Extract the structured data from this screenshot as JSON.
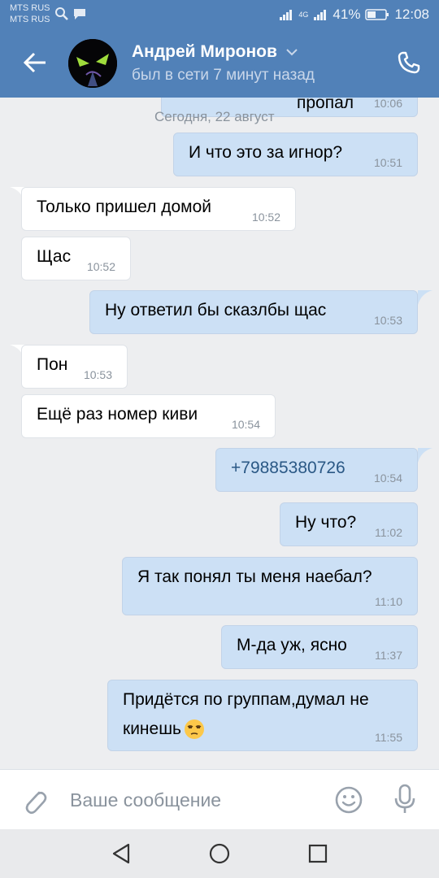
{
  "statusbar": {
    "carrier1": "MTS RUS",
    "carrier2": "MTS RUS",
    "network": "4G",
    "battery": "41%",
    "time": "12:08"
  },
  "header": {
    "name": "Андрей Миронов",
    "status": "был в сети 7 минут назад"
  },
  "chat": {
    "partial_prev_text": "пропал",
    "partial_prev_time": "10:06",
    "date_separator": "Сегодня, 22 август",
    "messages": [
      {
        "dir": "out",
        "text": "И что это за игнор?",
        "time": "10:51"
      },
      {
        "dir": "in",
        "text": "Только пришел домой",
        "time": "10:52"
      },
      {
        "dir": "in",
        "text": "Щас",
        "time": "10:52"
      },
      {
        "dir": "out",
        "text": "Ну ответил бы сказлбы щас",
        "time": "10:53"
      },
      {
        "dir": "in",
        "text": "Пон",
        "time": "10:53"
      },
      {
        "dir": "in",
        "text": "Ещё раз номер киви",
        "time": "10:54"
      },
      {
        "dir": "out",
        "text": "+79885380726",
        "time": "10:54"
      },
      {
        "dir": "out",
        "text": "Ну что?",
        "time": "11:02"
      },
      {
        "dir": "out",
        "text": "Я так понял ты меня наебал?",
        "time": "11:10"
      },
      {
        "dir": "out",
        "text": "М-да уж, ясно",
        "time": "11:37"
      },
      {
        "dir": "out",
        "text_line1": "Придётся по группам,думал не",
        "text_line2": "кинешь",
        "time": "11:55"
      }
    ]
  },
  "input": {
    "placeholder": "Ваше сообщение"
  },
  "colors": {
    "header": "#5181b8",
    "incoming": "#ffffff",
    "outgoing": "#cce0f5",
    "background": "#edeef0",
    "link": "#2a5885"
  },
  "icons": [
    "search-icon",
    "chat-icon",
    "back-arrow-icon",
    "chevron-down-icon",
    "phone-icon",
    "paperclip-icon",
    "smile-icon",
    "mic-icon",
    "nav-back-icon",
    "nav-home-icon",
    "nav-recents-icon"
  ]
}
